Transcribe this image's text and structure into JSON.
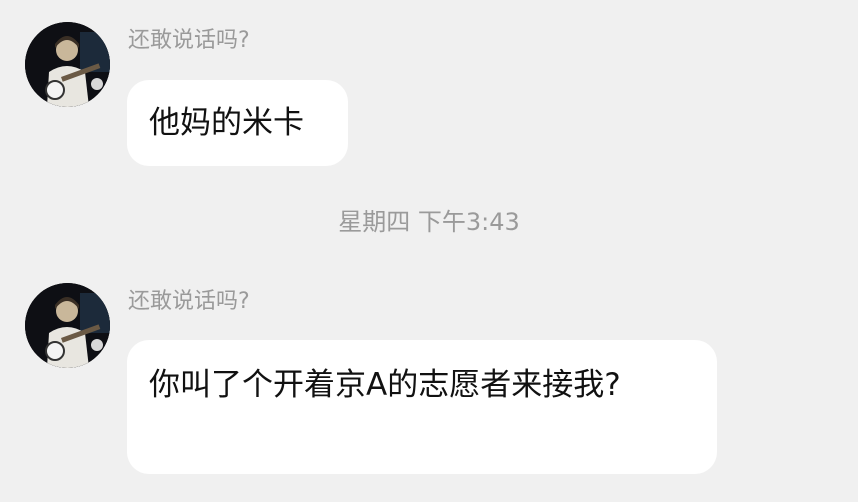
{
  "messages": [
    {
      "sender": "还敢说话吗?",
      "avatar_icon": "user-avatar-icon",
      "text": "他妈的米卡"
    },
    {
      "sender": "还敢说话吗?",
      "avatar_icon": "user-avatar-icon",
      "text": "你叫了个开着京A的志愿者来接我?"
    }
  ],
  "timestamp": "星期四 下午3:43",
  "colors": {
    "background": "#f0f0f0",
    "bubble": "#ffffff",
    "meta_text": "#9a9a9a",
    "message_text": "#111111"
  }
}
